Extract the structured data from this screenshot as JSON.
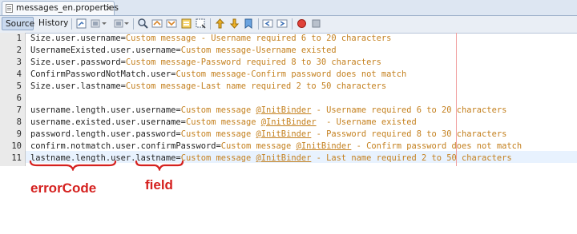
{
  "tab": {
    "filename": "messages_en.properties",
    "close": "×"
  },
  "toolbar": {
    "source_label": "Source",
    "history_label": "History"
  },
  "lines": [
    {
      "num": "1",
      "key": "Size.user.username",
      "value": "Custom message - Username required 6 to 20 characters"
    },
    {
      "num": "2",
      "key": "UsernameExisted.user.username",
      "value": "Custom message-Username existed"
    },
    {
      "num": "3",
      "key": "Size.user.password",
      "value": "Custom message-Password required 8 to 30 characters"
    },
    {
      "num": "4",
      "key": "ConfirmPasswordNotMatch.user",
      "value": "Custom message-Confirm password does not match"
    },
    {
      "num": "5",
      "key": "Size.user.lastname",
      "value": "Custom message-Last name required 2 to 50 characters"
    },
    {
      "num": "6",
      "key": "",
      "value": ""
    },
    {
      "num": "7",
      "key": "username.length.user.username",
      "value_pre": "Custom message ",
      "value_ib": "@InitBinder",
      "value_post": " - Username required 6 to 20 characters"
    },
    {
      "num": "8",
      "key": "username.existed.user.username",
      "value_pre": "Custom message ",
      "value_ib": "@InitBinder",
      "value_post": "  - Username existed"
    },
    {
      "num": "9",
      "key": "password.length.user.password",
      "value_pre": "Custom message ",
      "value_ib": "@InitBinder",
      "value_post": " - Password required 8 to 30 characters"
    },
    {
      "num": "10",
      "key": "confirm.notmatch.user.confirmPassword",
      "value_pre": "Custom message ",
      "value_ib": "@InitBinder",
      "value_post": " - Confirm password does not match"
    },
    {
      "num": "11",
      "key": "lastname.length.user.lastname",
      "value_pre": "Custom message ",
      "value_ib": "@InitBinder",
      "value_post": " - Last name required 2 to 50 characters"
    }
  ],
  "annotations": {
    "error_code": "errorCode",
    "field": "field"
  },
  "colors": {
    "value": "#c4801e",
    "annotation": "#d5211f",
    "current_line": "#e8f2fe"
  }
}
